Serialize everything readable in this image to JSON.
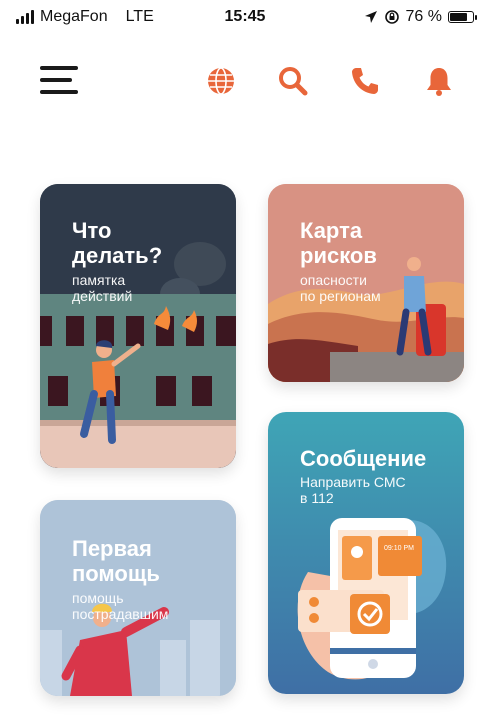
{
  "status_bar": {
    "carrier": "MegaFon",
    "network": "LTE",
    "time": "15:45",
    "battery": "76 %",
    "battery_level": 0.76,
    "icons": [
      "signal-icon",
      "location-arrow-icon",
      "orientation-lock-icon",
      "battery-icon"
    ]
  },
  "app_bar": {
    "icons": [
      "menu-icon",
      "globe-icon",
      "search-icon",
      "phone-icon",
      "bell-icon"
    ],
    "accent_color": "#e8663a"
  },
  "cards": [
    {
      "id": "what-to-do",
      "title": "Что\nделать?",
      "subtitle": "памятка\nдействий",
      "bg": "#2f3a4a"
    },
    {
      "id": "risk-map",
      "title": "Карта\nрисков",
      "subtitle": "опасности\nпо регионам",
      "bg": "#d89283"
    },
    {
      "id": "message",
      "title": "Сообщение",
      "subtitle": "Направить СМС\nв 112",
      "bg": "#3f98b6"
    },
    {
      "id": "first-aid",
      "title": "Первая\nпомощь",
      "subtitle": "помощь\nпострадавшим",
      "bg": "#aec3d8"
    }
  ],
  "phone_card": {
    "time": "09:10 PM"
  }
}
